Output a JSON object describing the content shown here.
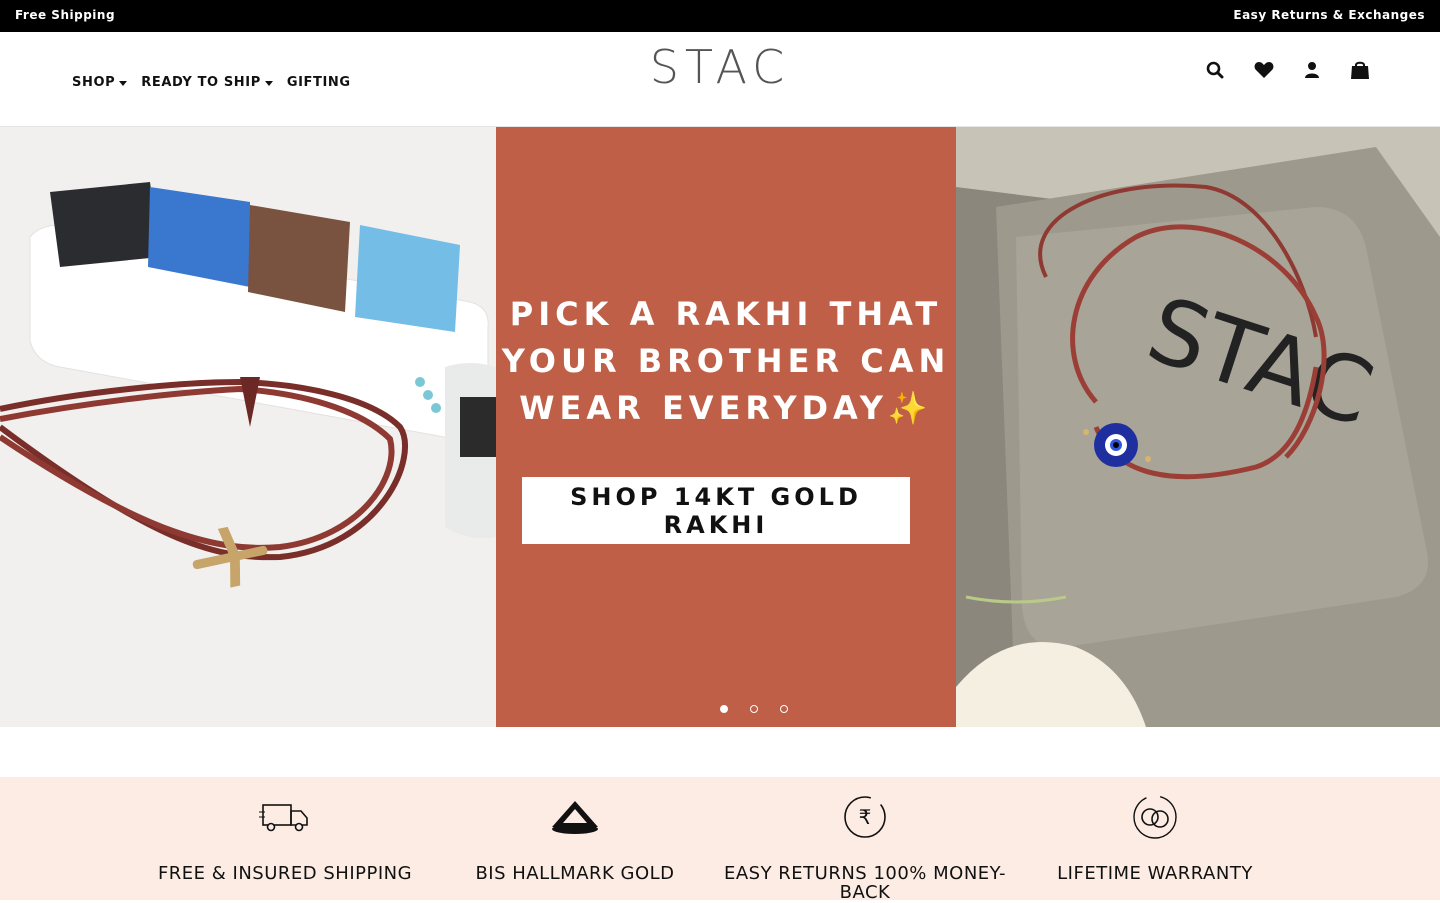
{
  "topbar": {
    "left": "Free Shipping",
    "right": "Easy Returns & Exchanges"
  },
  "header": {
    "logo": "STAC",
    "nav": [
      {
        "label": "SHOP",
        "dropdown": true
      },
      {
        "label": "READY TO SHIP",
        "dropdown": true
      },
      {
        "label": "GIFTING",
        "dropdown": false
      }
    ],
    "icons": [
      "search-icon",
      "wishlist-heart-icon",
      "account-icon",
      "cart-bag-icon"
    ]
  },
  "hero": {
    "headline": "PICK A RAKHI THAT YOUR BROTHER CAN WEAR EVERYDAY✨",
    "cta": "SHOP 14KT GOLD RAKHI",
    "box_print": "STAC",
    "slides_total": 3,
    "active_slide": 1,
    "colors": {
      "panel": "#bf5f47",
      "cord": "#8e3a33"
    }
  },
  "features": [
    {
      "label": "FREE & INSURED SHIPPING",
      "icon": "delivery-truck-icon"
    },
    {
      "label": "BIS HALLMARK GOLD",
      "icon": "bis-hallmark-icon"
    },
    {
      "label": "EASY RETURNS 100% MONEY-BACK",
      "icon": "rupee-return-icon"
    },
    {
      "label": "LIFETIME WARRANTY",
      "icon": "rings-warranty-icon"
    }
  ],
  "colors": {
    "topbar": "#000000",
    "features_bg": "#fcece4"
  }
}
